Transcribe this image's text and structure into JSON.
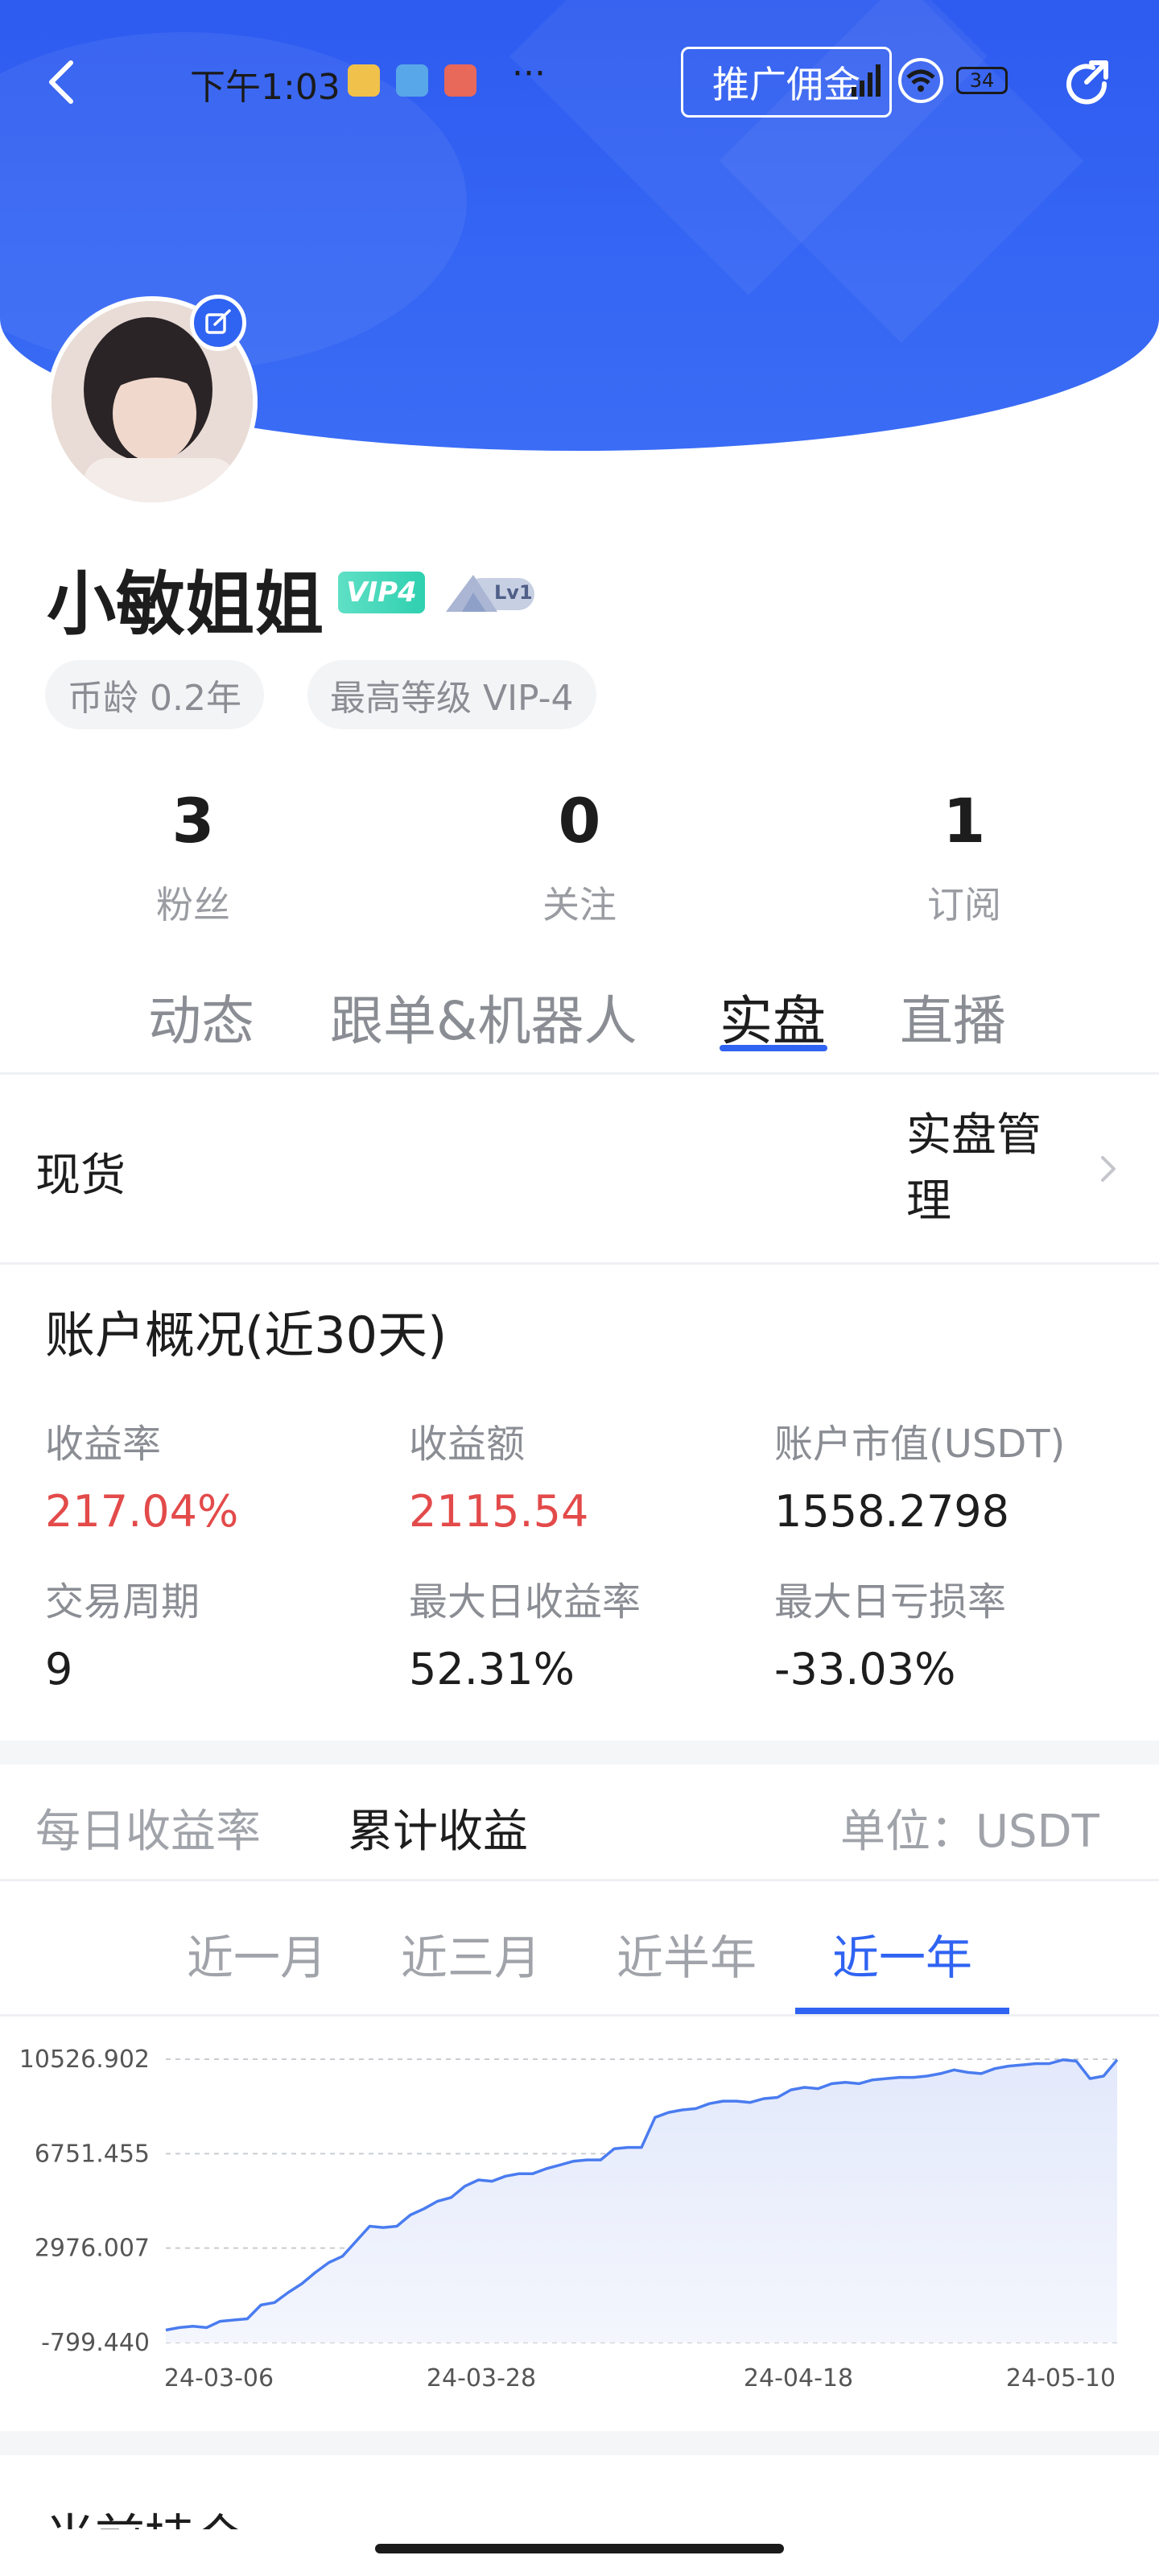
{
  "status_bar": {
    "time": "下午1:03",
    "more": "···",
    "battery": "34"
  },
  "header": {
    "promo_label": "推广佣金"
  },
  "profile": {
    "name": "小敏姐姐",
    "vip_badge": "VIP4",
    "level_badge": "Lv1",
    "chips": [
      "币龄 0.2年",
      "最高等级 VIP-4"
    ]
  },
  "stats": [
    {
      "value": "3",
      "label": "粉丝"
    },
    {
      "value": "0",
      "label": "关注"
    },
    {
      "value": "1",
      "label": "订阅"
    }
  ],
  "tabs": [
    "动态",
    "跟单&机器人",
    "实盘",
    "直播"
  ],
  "active_tab": "实盘",
  "account": {
    "market_label": "现货",
    "manage_label_line1": "实盘管",
    "manage_label_line2": "理"
  },
  "overview": {
    "title": "账户概况(近30天)",
    "metrics": [
      {
        "label": "收益率",
        "value": "217.04%"
      },
      {
        "label": "收益额",
        "value": "2115.54"
      },
      {
        "label": "账户市值(USDT)",
        "value": "1558.2798"
      },
      {
        "label": "交易周期",
        "value": "9"
      },
      {
        "label": "最大日收益率",
        "value": "52.31%"
      },
      {
        "label": "最大日亏损率",
        "value": "-33.03%"
      }
    ]
  },
  "chart_tabs": {
    "daily": "每日收益率",
    "cumulative": "累计收益",
    "unit": "单位：USDT"
  },
  "ranges": [
    "近一月",
    "近三月",
    "近半年",
    "近一年"
  ],
  "active_range": "近一年",
  "colors": {
    "brand_blue": "#2f63f2",
    "positive_red": "#e34a4a",
    "vip_green": "#2fd0b0"
  },
  "chart_data": {
    "type": "area",
    "title": "",
    "xlabel": "",
    "ylabel": "",
    "x_ticks": [
      "24-03-06",
      "24-03-28",
      "24-04-18",
      "24-05-10"
    ],
    "y_ticks": [
      "10526.902",
      "6751.455",
      "2976.007",
      "-799.440"
    ],
    "ylim": [
      -799.44,
      10526.902
    ],
    "series": [
      {
        "values": [
          -300,
          -200,
          -150,
          -200,
          50,
          100,
          150,
          700,
          800,
          1200,
          1550,
          2000,
          2400,
          2650,
          3250,
          3850,
          3800,
          3850,
          4300,
          4550,
          4850,
          5000,
          5450,
          5700,
          5650,
          5850,
          5950,
          5950,
          6150,
          6300,
          6450,
          6500,
          6500,
          6950,
          7000,
          7000,
          8200,
          8400,
          8500,
          8550,
          8750,
          8850,
          8850,
          8800,
          8950,
          9000,
          9300,
          9400,
          9350,
          9550,
          9600,
          9550,
          9700,
          9750,
          9800,
          9800,
          9850,
          9950,
          10100,
          10000,
          9950,
          10150,
          10250,
          10300,
          10350,
          10350,
          10500,
          10450,
          9750,
          9850,
          10500
        ]
      }
    ],
    "grid": true,
    "legend": "none"
  },
  "next_section": {
    "title": "当前持仓"
  }
}
